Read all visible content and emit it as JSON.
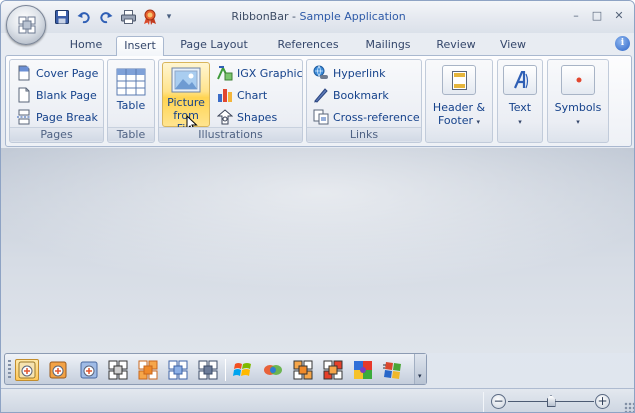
{
  "window": {
    "title_prefix": "RibbonBar",
    "title_separator": " - ",
    "title_app": "Sample Application",
    "controls": {
      "minimize": "–",
      "maximize": "□",
      "close": "✕"
    }
  },
  "quick_access": [
    "save-icon",
    "undo-icon",
    "redo-icon",
    "print-icon",
    "ribbon-award-icon"
  ],
  "quick_access_customize": "▾",
  "tabs": [
    {
      "label": "Home",
      "active": false
    },
    {
      "label": "Insert",
      "active": true
    },
    {
      "label": "Page Layout",
      "active": false
    },
    {
      "label": "References",
      "active": false
    },
    {
      "label": "Mailings",
      "active": false
    },
    {
      "label": "Review",
      "active": false
    },
    {
      "label": "View",
      "active": false
    }
  ],
  "help_label": "i",
  "groups": {
    "pages": {
      "label": "Pages",
      "items": [
        {
          "label": "Cover Page",
          "icon": "cover-page-icon"
        },
        {
          "label": "Blank Page",
          "icon": "blank-page-icon"
        },
        {
          "label": "Page Break",
          "icon": "page-break-icon"
        }
      ]
    },
    "table": {
      "label": "Table",
      "button": "Table",
      "icon": "table-icon"
    },
    "illustrations": {
      "label": "Illustrations",
      "picture_line1": "Picture",
      "picture_line2": "from File",
      "items": [
        {
          "label": "IGX Graphic",
          "icon": "igx-graphic-icon"
        },
        {
          "label": "Chart",
          "icon": "chart-icon"
        },
        {
          "label": "Shapes",
          "icon": "shapes-icon"
        }
      ]
    },
    "links": {
      "label": "Links",
      "items": [
        {
          "label": "Hyperlink",
          "icon": "hyperlink-icon"
        },
        {
          "label": "Bookmark",
          "icon": "bookmark-icon"
        },
        {
          "label": "Cross-reference",
          "icon": "cross-reference-icon"
        }
      ]
    },
    "header_footer": {
      "line1": "Header &",
      "line2": "Footer",
      "arrow": "▾"
    },
    "text": {
      "label": "Text",
      "arrow": "▾"
    },
    "symbols": {
      "label": "Symbols",
      "arrow": "▾"
    }
  },
  "toolbar": {
    "overflow": "▾",
    "buttons": [
      "style-office-2007-blue-icon",
      "style-office-2007-black-icon",
      "style-office-2007-silver-icon",
      "layout-grid-black-icon",
      "layout-grid-orange-icon",
      "layout-grid-blue-icon",
      "layout-grid-dark-icon",
      "windows-flag-icon",
      "windows-xp-icon",
      "grid-orange-icon",
      "grid-red-icon",
      "puzzle-icon",
      "windows-classic-icon"
    ]
  },
  "statusbar": {
    "zoom_minus": "−",
    "zoom_plus": "+",
    "zoom_level": 0.5
  }
}
